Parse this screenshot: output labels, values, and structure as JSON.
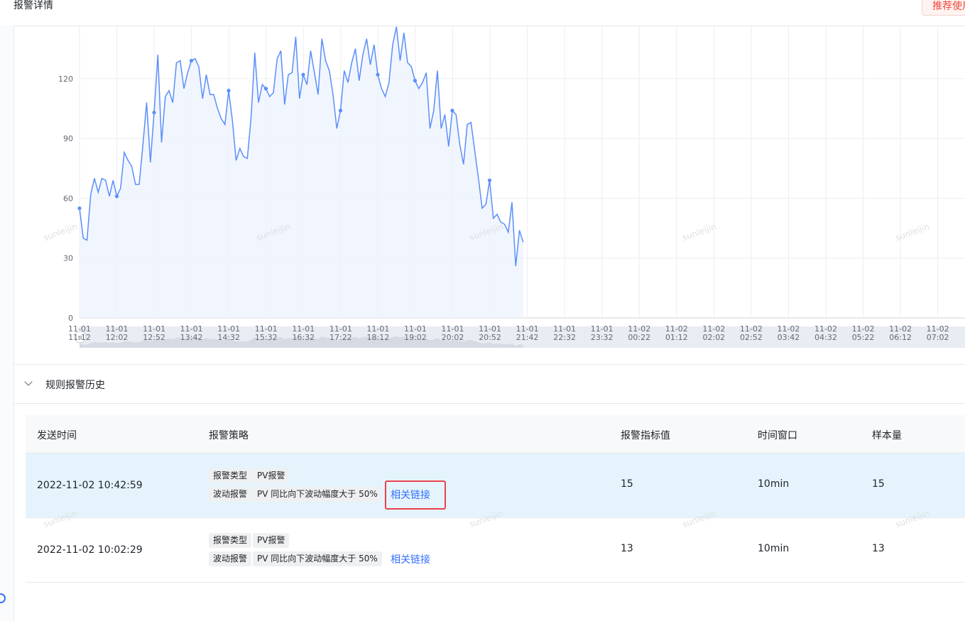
{
  "header": {
    "title": "报警详情",
    "recommend_label": "推荐使用"
  },
  "watermark": "sunleijin",
  "chart_data": {
    "type": "line",
    "title": "",
    "xlabel": "",
    "ylabel": "",
    "ylim": [
      0,
      150
    ],
    "yticks": [
      0,
      30,
      60,
      90,
      120
    ],
    "grid": true,
    "xticks": [
      {
        "date": "11-01",
        "time": "11:12"
      },
      {
        "date": "11-01",
        "time": "12:02"
      },
      {
        "date": "11-01",
        "time": "12:52"
      },
      {
        "date": "11-01",
        "time": "13:42"
      },
      {
        "date": "11-01",
        "time": "14:32"
      },
      {
        "date": "11-01",
        "time": "15:32"
      },
      {
        "date": "11-01",
        "time": "16:32"
      },
      {
        "date": "11-01",
        "time": "17:22"
      },
      {
        "date": "11-01",
        "time": "18:12"
      },
      {
        "date": "11-01",
        "time": "19:02"
      },
      {
        "date": "11-01",
        "time": "20:02"
      },
      {
        "date": "11-01",
        "time": "20:52"
      },
      {
        "date": "11-01",
        "time": "21:42"
      },
      {
        "date": "11-01",
        "time": "22:32"
      },
      {
        "date": "11-01",
        "time": "23:32"
      },
      {
        "date": "11-02",
        "time": "00:22"
      },
      {
        "date": "11-02",
        "time": "01:12"
      },
      {
        "date": "11-02",
        "time": "02:02"
      },
      {
        "date": "11-02",
        "time": "02:52"
      },
      {
        "date": "11-02",
        "time": "03:42"
      },
      {
        "date": "11-02",
        "time": "04:32"
      },
      {
        "date": "11-02",
        "time": "05:22"
      },
      {
        "date": "11-02",
        "time": "06:12"
      },
      {
        "date": "11-02",
        "time": "07:02"
      }
    ],
    "series": [
      {
        "color": "#5b8ff9",
        "values": [
          55,
          40,
          39,
          62,
          70,
          63,
          70,
          69,
          61,
          69,
          61,
          65,
          83,
          79,
          76,
          67,
          67,
          87,
          108,
          78,
          103,
          132,
          88,
          111,
          114,
          108,
          128,
          129,
          115,
          123,
          129,
          130,
          126,
          110,
          122,
          112,
          112,
          105,
          100,
          97,
          114,
          99,
          79,
          85,
          81,
          80,
          100,
          133,
          108,
          117,
          115,
          111,
          113,
          130,
          134,
          107,
          122,
          123,
          141,
          110,
          122,
          117,
          134,
          123,
          112,
          140,
          129,
          124,
          112,
          95,
          104,
          124,
          118,
          128,
          135,
          119,
          132,
          140,
          127,
          137,
          122,
          115,
          111,
          118,
          137,
          146,
          129,
          143,
          128,
          126,
          119,
          115,
          118,
          123,
          95,
          104,
          124,
          95,
          102,
          86,
          104,
          102,
          87,
          77,
          97,
          98,
          84,
          70,
          55,
          57,
          69,
          50,
          52,
          48,
          47,
          43,
          58,
          26,
          44,
          38
        ]
      }
    ]
  },
  "history": {
    "section_title": "规则报警历史",
    "columns": [
      "发送时间",
      "报警策略",
      "报警指标值",
      "时间窗口",
      "样本量"
    ],
    "rows": [
      {
        "time": "2022-11-02 10:42:59",
        "type_key": "报警类型",
        "type_val": "PV报警",
        "strategy_key": "波动报警",
        "strategy_val": "PV 同比向下波动幅度大于 50%",
        "link": "相关链接",
        "value": "15",
        "window": "10min",
        "sample": "15"
      },
      {
        "time": "2022-11-02 10:02:29",
        "type_key": "报警类型",
        "type_val": "PV报警",
        "strategy_key": "波动报警",
        "strategy_val": "PV 同比向下波动幅度大于 50%",
        "link": "相关链接",
        "value": "13",
        "window": "10min",
        "sample": "13"
      }
    ]
  }
}
